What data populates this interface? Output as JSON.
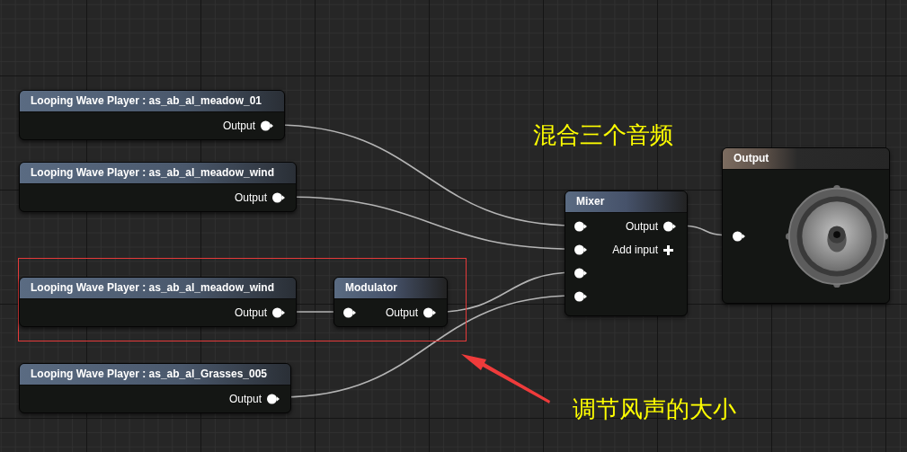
{
  "graph": {
    "nodes": [
      {
        "kind": "wave_player",
        "title": "Looping Wave Player : as_ab_al_meadow_01",
        "output": "Output"
      },
      {
        "kind": "wave_player",
        "title": "Looping Wave Player : as_ab_al_meadow_wind",
        "output": "Output"
      },
      {
        "kind": "wave_player",
        "title": "Looping Wave Player : as_ab_al_meadow_wind",
        "output": "Output"
      },
      {
        "kind": "modulator",
        "title": "Modulator",
        "output": "Output"
      },
      {
        "kind": "wave_player",
        "title": "Looping Wave Player : as_ab_al_Grasses_005",
        "output": "Output"
      },
      {
        "kind": "mixer",
        "title": "Mixer",
        "output": "Output",
        "add_input": "Add input"
      },
      {
        "kind": "output",
        "title": "Output"
      }
    ]
  },
  "annotations": [
    {
      "text": "混合三个音频"
    },
    {
      "text": "调节风声的大小"
    }
  ]
}
